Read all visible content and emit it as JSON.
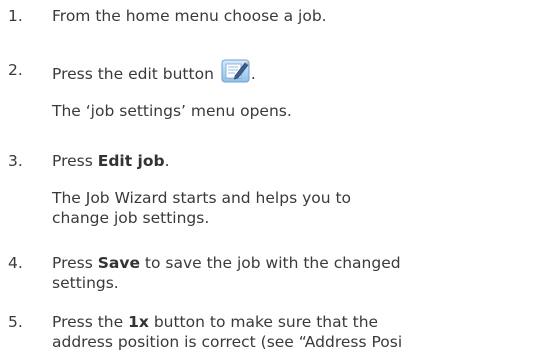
{
  "steps": [
    {
      "number": "1.",
      "text": "From the home menu choose a job."
    },
    {
      "number": "2.",
      "text_before_icon": "Press the edit button",
      "icon": "edit-button-icon",
      "text_after_icon": ".",
      "note": "The ‘job settings’ menu opens."
    },
    {
      "number": "3.",
      "text_before_bold": "Press ",
      "bold": "Edit job",
      "text_after_bold": ".",
      "note_line1": "The Job Wizard starts and helps you to",
      "note_line2": "change job settings."
    },
    {
      "number": "4.",
      "text_before_bold": "Press ",
      "bold": "Save",
      "text_after_bold": " to save the job with the changed",
      "line2": "settings."
    },
    {
      "number": "5.",
      "text_before_bold": "Press the ",
      "bold": "1x",
      "text_after_bold": " button to make sure that the",
      "line2": "address position is correct (see “Address Posi"
    }
  ],
  "colors": {
    "text": "#3a3a3a",
    "icon_blue": "#5b8fc9",
    "icon_paper": "#ffffff"
  }
}
